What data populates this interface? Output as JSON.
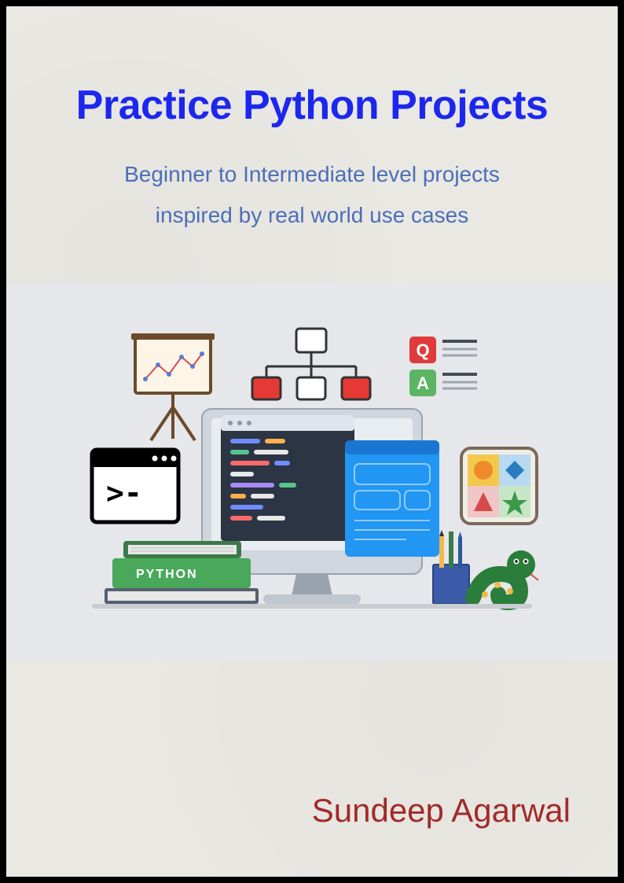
{
  "title": "Practice Python Projects",
  "subtitle_line1": "Beginner to Intermediate level projects",
  "subtitle_line2": "inspired by real world use cases",
  "author": "Sundeep Agarwal",
  "book_label": "PYTHON",
  "qa": {
    "q": "Q",
    "a": "A"
  }
}
